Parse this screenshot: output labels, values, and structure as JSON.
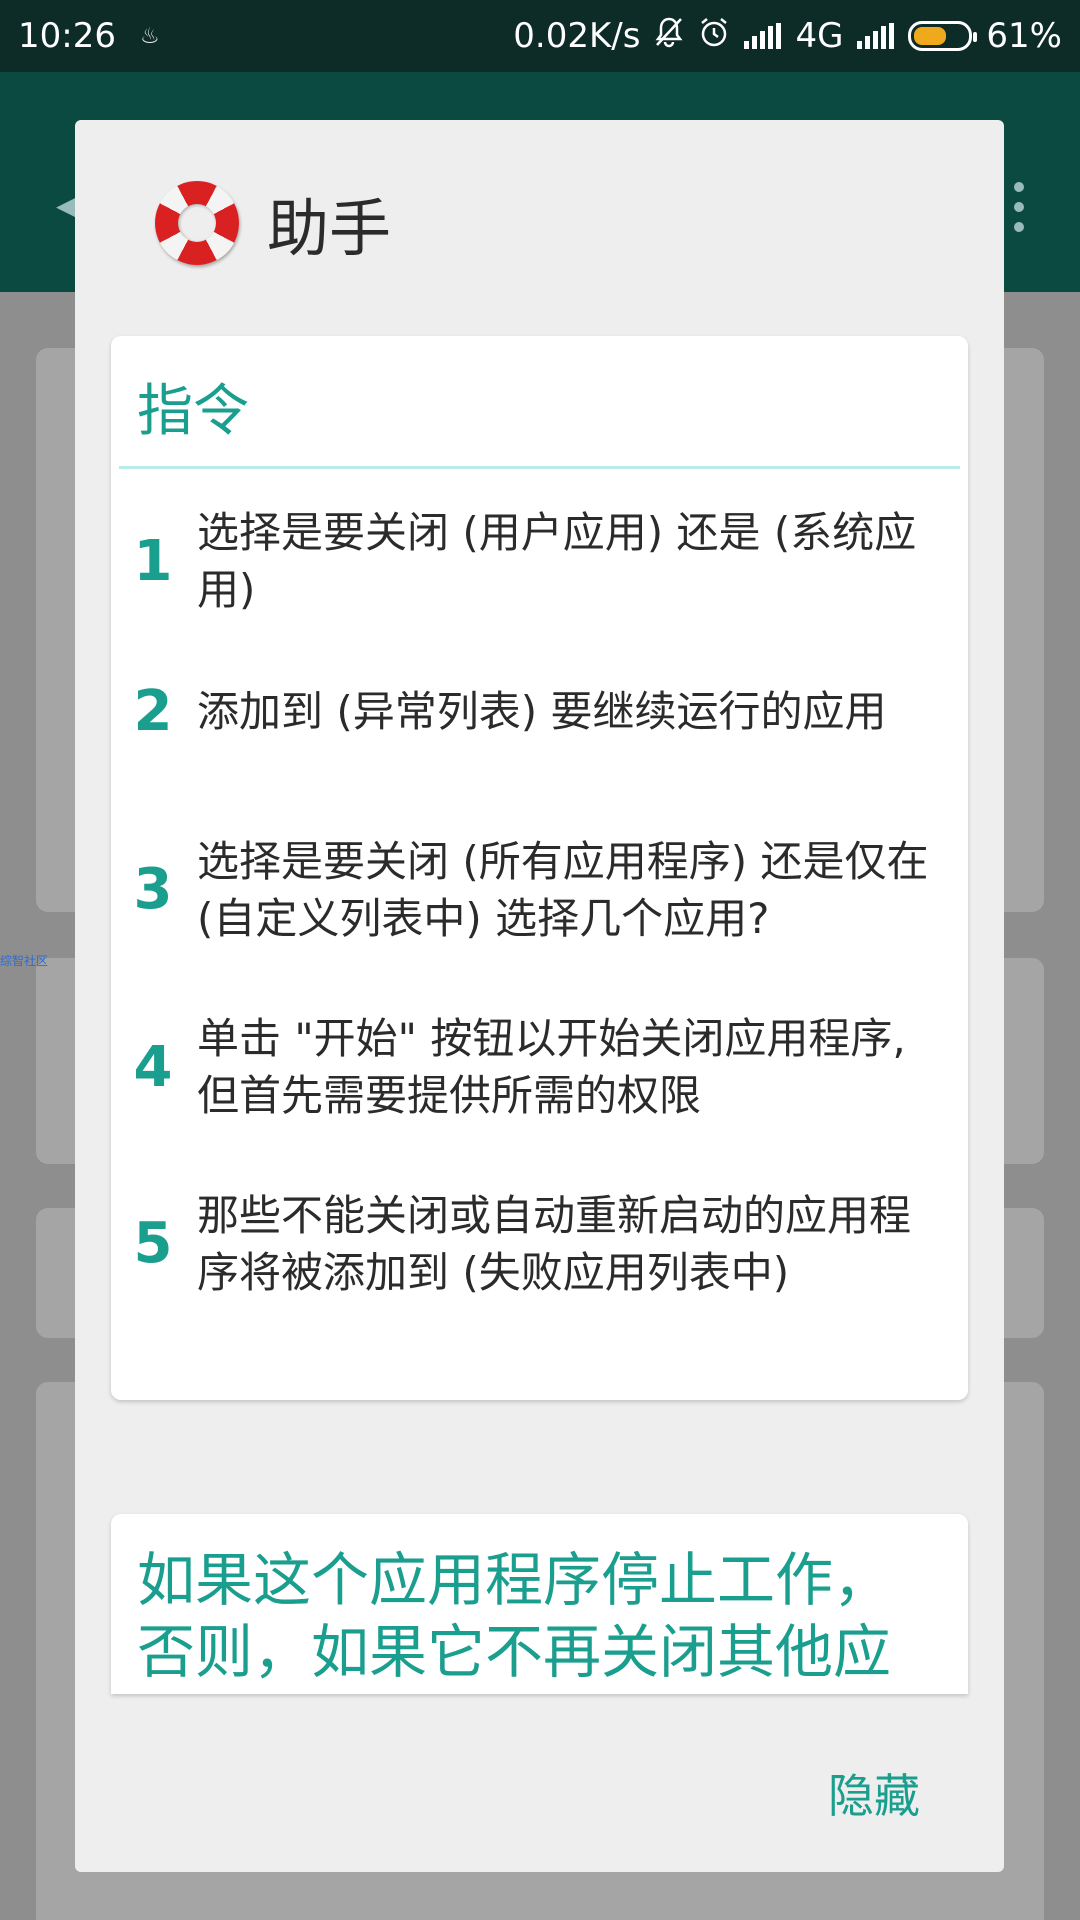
{
  "status_bar": {
    "time": "10:26",
    "net_speed": "0.02K/s",
    "network_type": "4G",
    "battery": "61%",
    "battery_level": 0.61,
    "icons": [
      "notification-small-icon",
      "bell-muted-icon",
      "alarm-icon",
      "signal-icon",
      "signal-icon",
      "battery-icon"
    ]
  },
  "dialog": {
    "title": "助手",
    "icon": "lifebuoy-icon",
    "instructions": {
      "title": "指令",
      "steps": [
        {
          "num": "1",
          "text": "选择是要关闭 (用户应用) 还是 (系统应用)"
        },
        {
          "num": "2",
          "text": "添加到 (异常列表) 要继续运行的应用"
        },
        {
          "num": "3",
          "text": "选择是要关闭 (所有应用程序) 还是仅在 (自定义列表中) 选择几个应用?"
        },
        {
          "num": "4",
          "text": "单击 \"开始\" 按钮以开始关闭应用程序, 但首先需要提供所需的权限"
        },
        {
          "num": "5",
          "text": "那些不能关闭或自动重新启动的应用程序将被添加到 (失败应用列表中)"
        }
      ]
    },
    "warning": {
      "text": "如果这个应用程序停止工作，否则，如果它不再关闭其他应"
    },
    "hide_label": "隐藏"
  },
  "colors": {
    "accent": "#1a9e8e",
    "status_bar": "#0d2b27",
    "dialog_bg": "#eeeeee",
    "card_bg": "#ffffff"
  }
}
